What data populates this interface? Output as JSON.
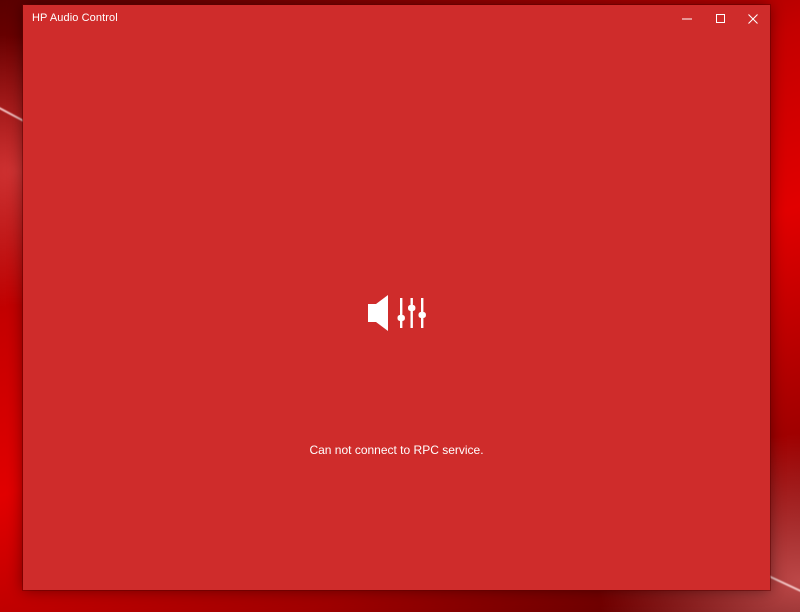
{
  "window": {
    "title": "HP Audio Control",
    "accent_color": "#cf2c2b",
    "caption_buttons": {
      "minimize_icon": "minimize-icon",
      "maximize_icon": "maximize-icon",
      "close_icon": "close-icon"
    }
  },
  "main": {
    "icon": "speaker-equalizer-icon",
    "status_message": "Can not connect to RPC service."
  }
}
